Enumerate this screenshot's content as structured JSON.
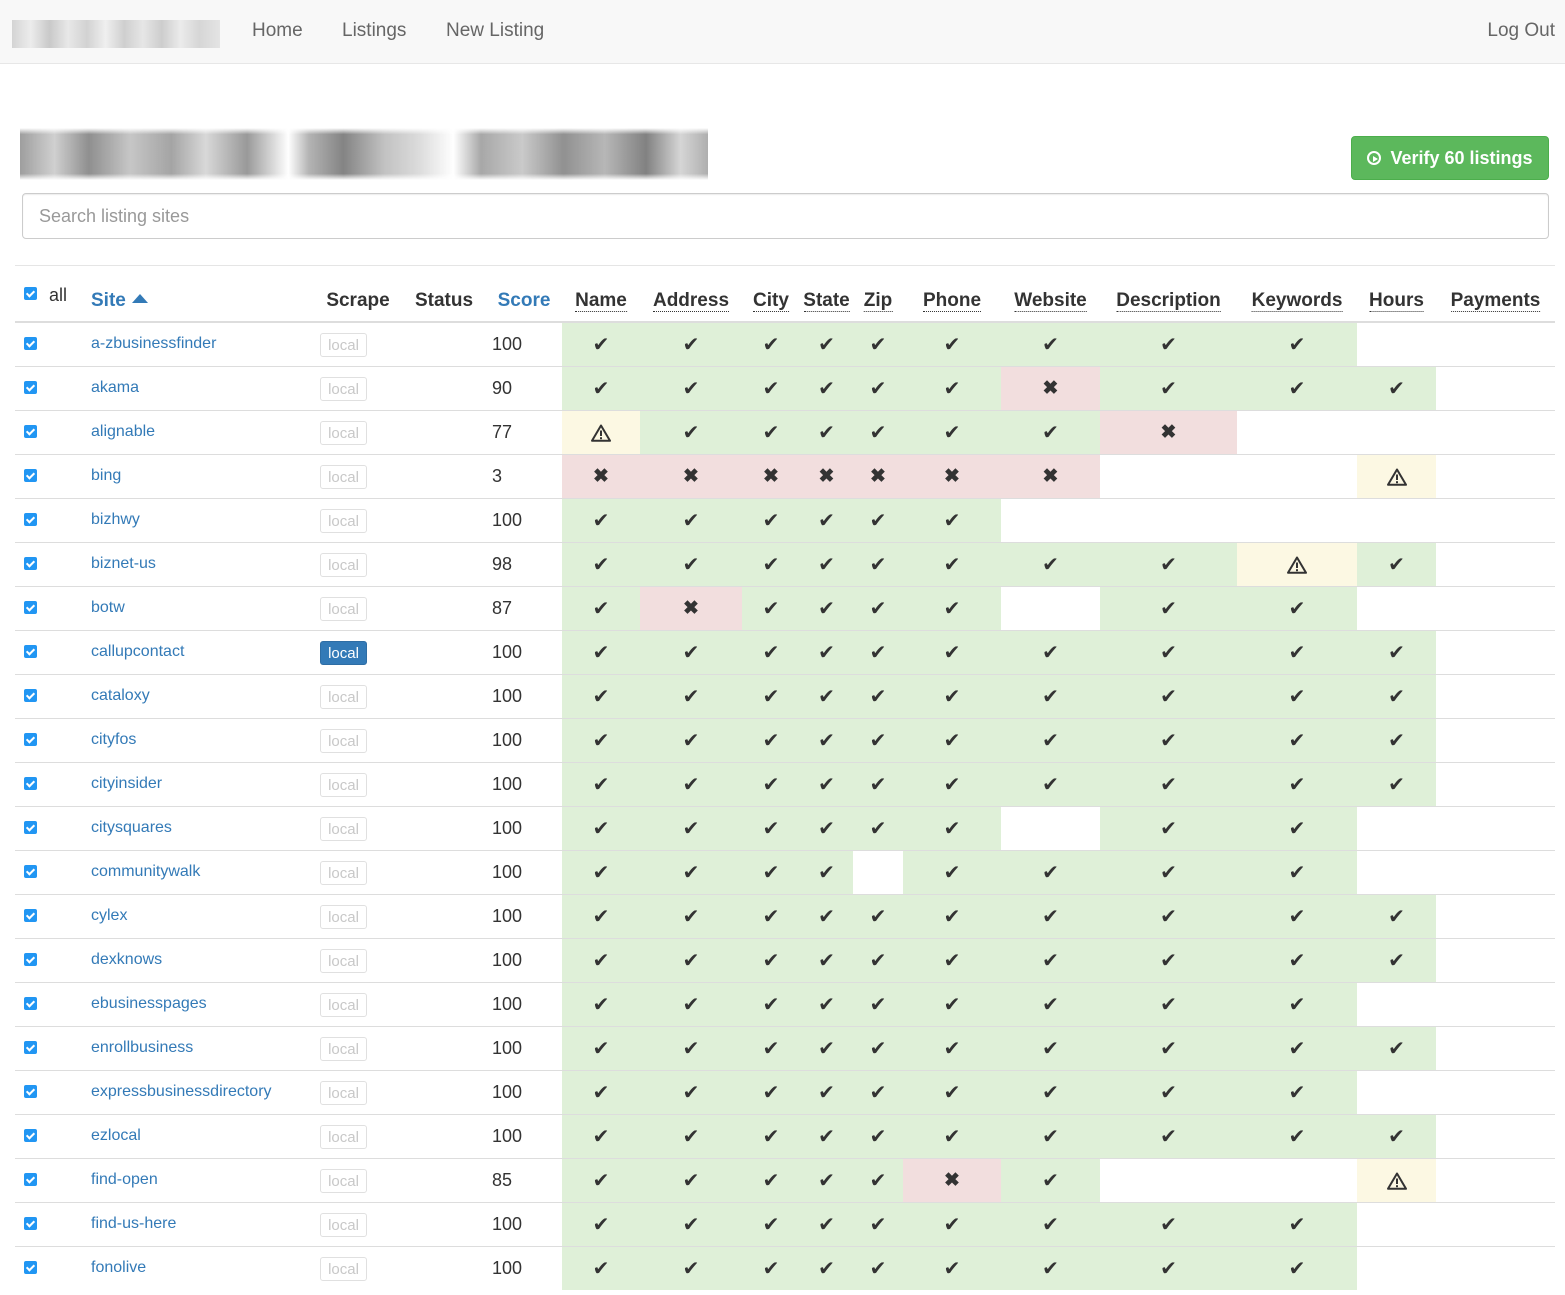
{
  "nav": {
    "links": [
      "Home",
      "Listings",
      "New Listing"
    ],
    "logout": "Log Out"
  },
  "header": {
    "verify_label": "Verify 60 listings",
    "search_placeholder": "Search listing sites"
  },
  "table": {
    "all_label": "all",
    "columns": {
      "site": "Site",
      "scrape": "Scrape",
      "status": "Status",
      "score": "Score",
      "fields": [
        "Name",
        "Address",
        "City",
        "State",
        "Zip",
        "Phone",
        "Website",
        "Description",
        "Keywords",
        "Hours",
        "Payments"
      ]
    },
    "status_colors": {
      "ok": "#dff0d8",
      "bad": "#f2dede",
      "warn": "#fcf8e3",
      "link": "#337ab7",
      "verify": "#5cb85c"
    },
    "rows": [
      {
        "site": "a-zbusinessfinder",
        "scrape": "local",
        "active": false,
        "score": "100",
        "cells": [
          "ok",
          "ok",
          "ok",
          "ok",
          "ok",
          "ok",
          "ok",
          "ok",
          "ok",
          "",
          ""
        ]
      },
      {
        "site": "akama",
        "scrape": "local",
        "active": false,
        "score": "90",
        "cells": [
          "ok",
          "ok",
          "ok",
          "ok",
          "ok",
          "ok",
          "bad",
          "ok",
          "ok",
          "ok",
          ""
        ]
      },
      {
        "site": "alignable",
        "scrape": "local",
        "active": false,
        "score": "77",
        "cells": [
          "warn",
          "ok",
          "ok",
          "ok",
          "ok",
          "ok",
          "ok",
          "bad",
          "",
          "",
          ""
        ]
      },
      {
        "site": "bing",
        "scrape": "local",
        "active": false,
        "score": "3",
        "cells": [
          "bad",
          "bad",
          "bad",
          "bad",
          "bad",
          "bad",
          "bad",
          "",
          "",
          "warn",
          ""
        ]
      },
      {
        "site": "bizhwy",
        "scrape": "local",
        "active": false,
        "score": "100",
        "cells": [
          "ok",
          "ok",
          "ok",
          "ok",
          "ok",
          "ok",
          "",
          "",
          "",
          "",
          ""
        ]
      },
      {
        "site": "biznet-us",
        "scrape": "local",
        "active": false,
        "score": "98",
        "cells": [
          "ok",
          "ok",
          "ok",
          "ok",
          "ok",
          "ok",
          "ok",
          "ok",
          "warn",
          "ok",
          ""
        ]
      },
      {
        "site": "botw",
        "scrape": "local",
        "active": false,
        "score": "87",
        "cells": [
          "ok",
          "bad",
          "ok",
          "ok",
          "ok",
          "ok",
          "",
          "ok",
          "ok",
          "",
          ""
        ]
      },
      {
        "site": "callupcontact",
        "scrape": "local",
        "active": true,
        "score": "100",
        "cells": [
          "ok",
          "ok",
          "ok",
          "ok",
          "ok",
          "ok",
          "ok",
          "ok",
          "ok",
          "ok",
          ""
        ]
      },
      {
        "site": "cataloxy",
        "scrape": "local",
        "active": false,
        "score": "100",
        "cells": [
          "ok",
          "ok",
          "ok",
          "ok",
          "ok",
          "ok",
          "ok",
          "ok",
          "ok",
          "ok",
          ""
        ]
      },
      {
        "site": "cityfos",
        "scrape": "local",
        "active": false,
        "score": "100",
        "cells": [
          "ok",
          "ok",
          "ok",
          "ok",
          "ok",
          "ok",
          "ok",
          "ok",
          "ok",
          "ok",
          ""
        ]
      },
      {
        "site": "cityinsider",
        "scrape": "local",
        "active": false,
        "score": "100",
        "cells": [
          "ok",
          "ok",
          "ok",
          "ok",
          "ok",
          "ok",
          "ok",
          "ok",
          "ok",
          "ok",
          ""
        ]
      },
      {
        "site": "citysquares",
        "scrape": "local",
        "active": false,
        "score": "100",
        "cells": [
          "ok",
          "ok",
          "ok",
          "ok",
          "ok",
          "ok",
          "",
          "ok",
          "ok",
          "",
          ""
        ]
      },
      {
        "site": "communitywalk",
        "scrape": "local",
        "active": false,
        "score": "100",
        "cells": [
          "ok",
          "ok",
          "ok",
          "ok",
          "",
          "ok",
          "ok",
          "ok",
          "ok",
          "",
          ""
        ]
      },
      {
        "site": "cylex",
        "scrape": "local",
        "active": false,
        "score": "100",
        "cells": [
          "ok",
          "ok",
          "ok",
          "ok",
          "ok",
          "ok",
          "ok",
          "ok",
          "ok",
          "ok",
          ""
        ]
      },
      {
        "site": "dexknows",
        "scrape": "local",
        "active": false,
        "score": "100",
        "cells": [
          "ok",
          "ok",
          "ok",
          "ok",
          "ok",
          "ok",
          "ok",
          "ok",
          "ok",
          "ok",
          ""
        ]
      },
      {
        "site": "ebusinesspages",
        "scrape": "local",
        "active": false,
        "score": "100",
        "cells": [
          "ok",
          "ok",
          "ok",
          "ok",
          "ok",
          "ok",
          "ok",
          "ok",
          "ok",
          "",
          ""
        ]
      },
      {
        "site": "enrollbusiness",
        "scrape": "local",
        "active": false,
        "score": "100",
        "cells": [
          "ok",
          "ok",
          "ok",
          "ok",
          "ok",
          "ok",
          "ok",
          "ok",
          "ok",
          "ok",
          ""
        ]
      },
      {
        "site": "expressbusinessdirectory",
        "scrape": "local",
        "active": false,
        "score": "100",
        "cells": [
          "ok",
          "ok",
          "ok",
          "ok",
          "ok",
          "ok",
          "ok",
          "ok",
          "ok",
          "",
          ""
        ]
      },
      {
        "site": "ezlocal",
        "scrape": "local",
        "active": false,
        "score": "100",
        "cells": [
          "ok",
          "ok",
          "ok",
          "ok",
          "ok",
          "ok",
          "ok",
          "ok",
          "ok",
          "ok",
          ""
        ]
      },
      {
        "site": "find-open",
        "scrape": "local",
        "active": false,
        "score": "85",
        "cells": [
          "ok",
          "ok",
          "ok",
          "ok",
          "ok",
          "bad",
          "ok",
          "",
          "",
          "warn",
          ""
        ]
      },
      {
        "site": "find-us-here",
        "scrape": "local",
        "active": false,
        "score": "100",
        "cells": [
          "ok",
          "ok",
          "ok",
          "ok",
          "ok",
          "ok",
          "ok",
          "ok",
          "ok",
          "",
          ""
        ]
      },
      {
        "site": "fonolive",
        "scrape": "local",
        "active": false,
        "score": "100",
        "cells": [
          "ok",
          "ok",
          "ok",
          "ok",
          "ok",
          "ok",
          "ok",
          "ok",
          "ok",
          "",
          ""
        ]
      }
    ]
  }
}
